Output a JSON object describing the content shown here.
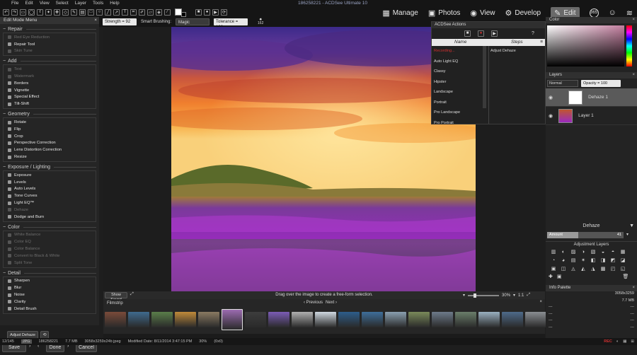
{
  "app": {
    "title": "186258221 - ACDSee Ultimate 10",
    "menu": [
      "File",
      "Edit",
      "View",
      "Select",
      "Layer",
      "Tools",
      "Help"
    ],
    "modes": [
      {
        "label": "Manage",
        "icon": "grid-icon"
      },
      {
        "label": "Photos",
        "icon": "photos-icon"
      },
      {
        "label": "View",
        "icon": "eye-icon"
      },
      {
        "label": "Develop",
        "icon": "develop-icon"
      },
      {
        "label": "Edit",
        "icon": "edit-icon",
        "active": true
      }
    ],
    "mode_badge": "365"
  },
  "brushbar": {
    "strength": "Strength = 92",
    "smart_label": "Smart Brushing:",
    "smart_value": "Magic",
    "tolerance": "Tolerance = 100",
    "size_value": "162"
  },
  "left_panel": {
    "title": "Edit Mode Menu",
    "groups": [
      {
        "name": "Repair",
        "items": [
          {
            "label": "Red Eye Reduction",
            "enabled": false
          },
          {
            "label": "Repair Tool",
            "enabled": true
          },
          {
            "label": "Skin Tune",
            "enabled": false
          }
        ]
      },
      {
        "name": "Add",
        "items": [
          {
            "label": "Text",
            "enabled": false
          },
          {
            "label": "Watermark",
            "enabled": false
          },
          {
            "label": "Borders",
            "enabled": true
          },
          {
            "label": "Vignette",
            "enabled": true
          },
          {
            "label": "Special Effect",
            "enabled": true
          },
          {
            "label": "Tilt-Shift",
            "enabled": true
          }
        ]
      },
      {
        "name": "Geometry",
        "items": [
          {
            "label": "Rotate",
            "enabled": true
          },
          {
            "label": "Flip",
            "enabled": true
          },
          {
            "label": "Crop",
            "enabled": true
          },
          {
            "label": "Perspective Correction",
            "enabled": true
          },
          {
            "label": "Lens Distortion Correction",
            "enabled": true
          },
          {
            "label": "Resize",
            "enabled": true
          }
        ]
      },
      {
        "name": "Exposure / Lighting",
        "items": [
          {
            "label": "Exposure",
            "enabled": true
          },
          {
            "label": "Levels",
            "enabled": true
          },
          {
            "label": "Auto Levels",
            "enabled": true
          },
          {
            "label": "Tone Curves",
            "enabled": true
          },
          {
            "label": "Light EQ™",
            "enabled": true
          },
          {
            "label": "Dehaze",
            "enabled": false
          },
          {
            "label": "Dodge and Burn",
            "enabled": true
          }
        ]
      },
      {
        "name": "Color",
        "items": [
          {
            "label": "White Balance",
            "enabled": false
          },
          {
            "label": "Color EQ",
            "enabled": false
          },
          {
            "label": "Color Balance",
            "enabled": false
          },
          {
            "label": "Convert to Black & White",
            "enabled": false
          },
          {
            "label": "Split Tone",
            "enabled": false
          }
        ]
      },
      {
        "name": "Detail",
        "items": [
          {
            "label": "Sharpen",
            "enabled": true
          },
          {
            "label": "Blur",
            "enabled": true
          },
          {
            "label": "Noise",
            "enabled": true
          },
          {
            "label": "Clarity",
            "enabled": true
          },
          {
            "label": "Detail Brush",
            "enabled": true
          }
        ]
      }
    ],
    "adjust_button": "Adjust Dehaze",
    "save": "Save",
    "done": "Done",
    "cancel": "Cancel"
  },
  "canvas": {
    "show_saved": "Show Saved",
    "hint": "Drag over the image to create a free-form selection.",
    "zoom": "30%",
    "ratio": "1:1"
  },
  "filmstrip": {
    "title": "Filmstrip",
    "previous": "Previous",
    "next": "Next",
    "thumb_colors": [
      "#7a4b3a",
      "#3f6a8e",
      "#5a7e4a",
      "#c08a3a",
      "#8a7a62",
      "#9b6bb0",
      "#3d3d3d",
      "#7b5cb6",
      "#b0b0b0",
      "#cfd8e0",
      "#2d5d8b",
      "#3e6e9a",
      "#8aa0b0",
      "#7a8a5a",
      "#6d7a8a",
      "#6a7e6a",
      "#9ab0c0",
      "#4e6a8a",
      "#8a8e92",
      "#a08a6a",
      "#708090",
      "#b0a090",
      "#5a4a4a",
      "#c05a3a"
    ]
  },
  "actions_panel": {
    "title": "ACDSee Actions",
    "col_name": "Name",
    "col_steps": "Steps",
    "items": [
      "Recording...",
      "Auto Light EQ",
      "Classy",
      "Hipster",
      "Landscape",
      "Portrait",
      "Pro Landscape",
      "Pro Portrait"
    ],
    "steps": [
      "Adjust Dehaze"
    ]
  },
  "right_panel": {
    "color_title": "Color",
    "layers_title": "Layers",
    "blend_mode": "Normal",
    "opacity": "Opacity = 100",
    "layers": [
      {
        "name": "Dehaze 1",
        "selected": true
      },
      {
        "name": "Layer 1",
        "selected": false
      }
    ],
    "dehaze_title": "Dehaze",
    "amount_label": "Amount",
    "amount_value": "41",
    "amount": 0.41,
    "adjustment_layers_title": "Adjustment Layers",
    "info_title": "Info Palette",
    "info_rows": [
      {
        "left": "",
        "right": "3058x3259"
      },
      {
        "left": "",
        "right": "7.7 MB"
      },
      {
        "left": "---",
        "right": "---"
      },
      {
        "left": "---",
        "right": "---"
      },
      {
        "left": "---",
        "right": "---"
      },
      {
        "left": "---",
        "right": "---"
      }
    ]
  },
  "status": {
    "count": "12/145",
    "format": "JPG",
    "filename": "186258221",
    "size": "7.7 MB",
    "dims": "3058x3259x24b jpeg",
    "modified": "Modified Date: 8/11/2014 3:47:15 PM",
    "zoom": "30%",
    "coords": "(0x0)",
    "rec": "REC"
  },
  "colors": {
    "accent": "#6a6a6a",
    "rec": "#d03030"
  }
}
